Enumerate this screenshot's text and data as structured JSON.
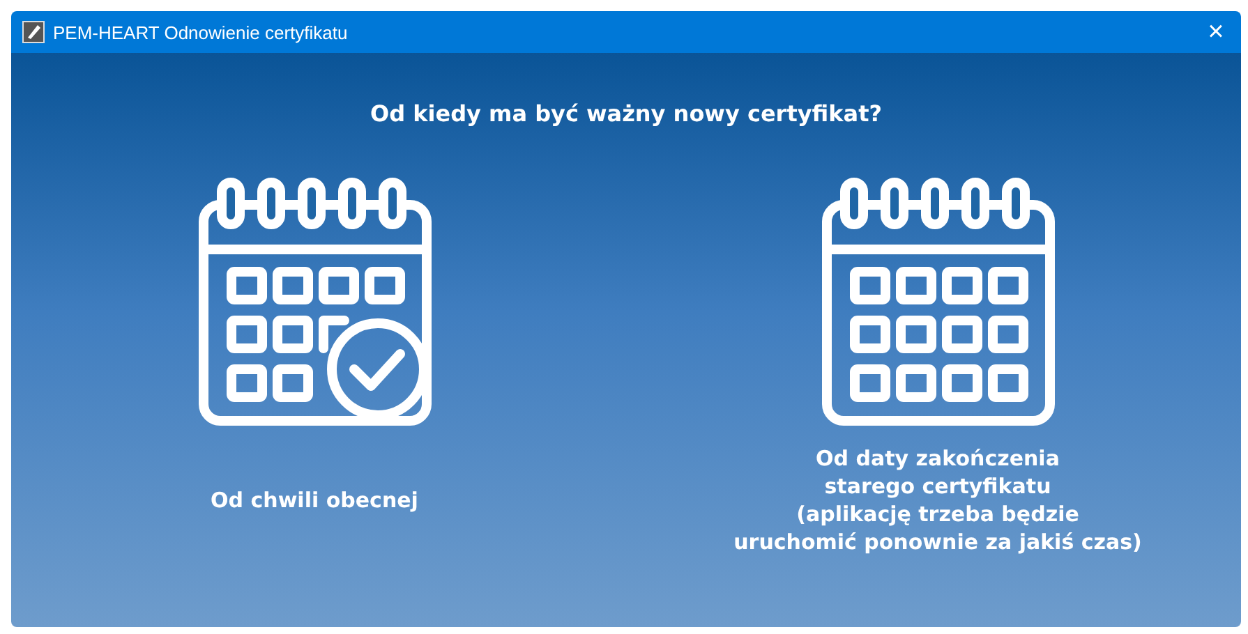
{
  "window": {
    "title": "PEM-HEART Odnowienie certyfikatu",
    "close": "×"
  },
  "question": "Od kiedy ma być ważny nowy certyfikat?",
  "options": [
    {
      "kind": "now",
      "label": "Od chwili obecnej"
    },
    {
      "kind": "later",
      "label": "Od daty zakończenia\nstarego certyfikatu\n(aplikację trzeba będzie\nuruchomić ponownie za jakiś czas)"
    }
  ]
}
